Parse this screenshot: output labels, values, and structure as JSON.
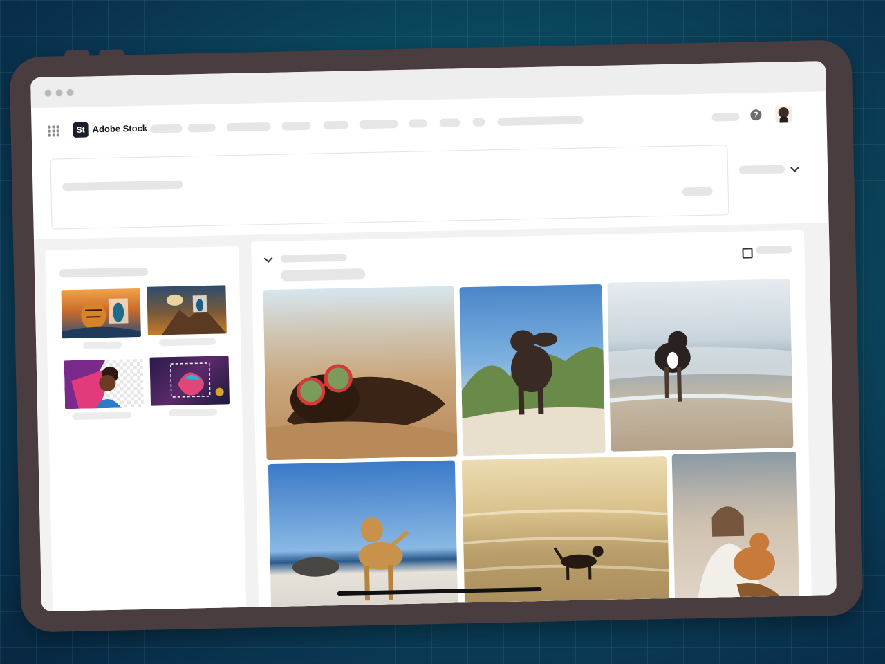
{
  "app": {
    "brand_logo": "St",
    "brand_name": "Adobe Stock"
  },
  "icons": {
    "apps": "apps-grid-icon",
    "help": "?",
    "expand": "chevron-down-icon",
    "sort": "chevron-down-icon",
    "checkbox": "checkbox-icon"
  },
  "colors": {
    "background": "#0b4f63",
    "device_frame": "#4a3d3f",
    "placeholder": "#e6e6e6",
    "brand": "#1b1f2a"
  },
  "sidebar": {
    "thumbnails": [
      {
        "icon": "tiger-peacock-composite-image"
      },
      {
        "icon": "fantasy-landscape-image"
      },
      {
        "icon": "portrait-remove-background-image"
      },
      {
        "icon": "betta-fish-selection-image"
      }
    ]
  },
  "results": {
    "photos": [
      {
        "icon": "dog-sunglasses-sand-photo"
      },
      {
        "icon": "spaniel-dunes-photo"
      },
      {
        "icon": "dog-running-shore-photo"
      },
      {
        "icon": "labrador-beach-photo"
      },
      {
        "icon": "dog-sunset-waves-photo"
      },
      {
        "icon": "woman-hugging-corgi-photo"
      }
    ]
  }
}
